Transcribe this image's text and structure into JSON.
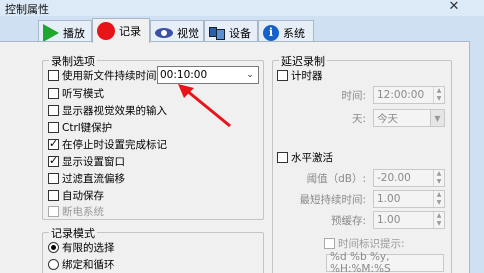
{
  "window": {
    "title": "控制属性",
    "close_label": "✕"
  },
  "tabs": [
    {
      "label": "播放",
      "icon": "play-icon"
    },
    {
      "label": "记录",
      "icon": "record-icon",
      "active": true
    },
    {
      "label": "视觉",
      "icon": "eye-icon"
    },
    {
      "label": "设备",
      "icon": "device-icon"
    },
    {
      "label": "系统",
      "icon": "info-icon"
    }
  ],
  "record_options": {
    "title": "录制选项",
    "use_new_file_label": "使用新文件持续时间:",
    "duration_value": "00:10:00",
    "items": [
      {
        "label": "听写模式",
        "checked": false
      },
      {
        "label": "显示器视觉效果的输入",
        "checked": false
      },
      {
        "label": "Ctrl键保护",
        "checked": false
      },
      {
        "label": "在停止时设置完成标记",
        "checked": true
      },
      {
        "label": "显示设置窗口",
        "checked": true
      },
      {
        "label": "过滤直流偏移",
        "checked": false
      },
      {
        "label": "自动保存",
        "checked": false
      },
      {
        "label": "断电系统",
        "checked": false,
        "disabled": true
      }
    ]
  },
  "record_mode": {
    "title": "记录模式",
    "options": [
      {
        "label": "有限的选择",
        "selected": true
      },
      {
        "label": "绑定和循环",
        "selected": false
      }
    ]
  },
  "delayed_record": {
    "title": "延迟录制",
    "timer_label": "计时器",
    "time_label": "时间:",
    "time_value": "12:00:00",
    "day_label": "天:",
    "day_value": "今天",
    "level_trigger_label": "水平激活",
    "threshold_label": "阈值（dB）:",
    "threshold_value": "-20.00",
    "min_duration_label": "最短持续时间:",
    "min_duration_value": "1.00",
    "pre_buffer_label": "预缓存:",
    "pre_buffer_value": "1.00",
    "timestamp_label": "时间标识提示:",
    "timestamp_value": "%d %b %y, %H:%M:%S"
  },
  "colors": {
    "accent_arrow": "#e8141a",
    "play": "#1fa82e",
    "record": "#e8141a"
  }
}
